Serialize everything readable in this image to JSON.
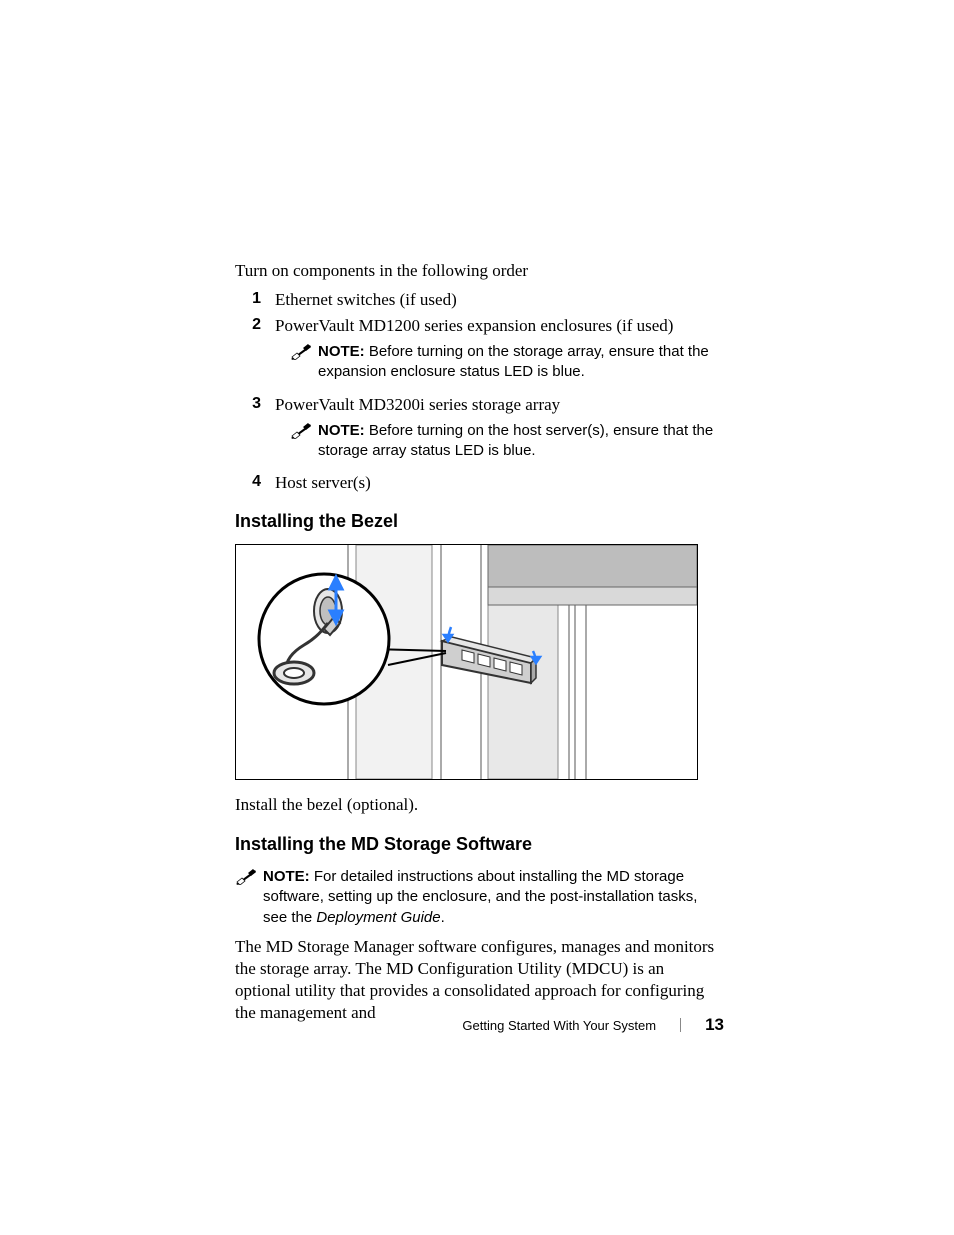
{
  "intro": "Turn on components in the following order",
  "steps": [
    {
      "n": "1",
      "text": "Ethernet switches (if used)"
    },
    {
      "n": "2",
      "text": "PowerVault MD1200 series expansion enclosures (if used)",
      "note": {
        "label": "NOTE:",
        "text": " Before turning on the storage array, ensure that the expansion enclosure status LED is blue."
      }
    },
    {
      "n": "3",
      "text": "PowerVault MD3200i series storage array",
      "note": {
        "label": "NOTE:",
        "text": " Before turning on the host server(s), ensure that the storage array status LED is blue."
      }
    },
    {
      "n": "4",
      "text": "Host server(s)"
    }
  ],
  "heading_bezel": "Installing the Bezel",
  "bezel_caption": "Install the bezel (optional).",
  "heading_software": "Installing the MD Storage Software",
  "software_note": {
    "label": "NOTE:",
    "text": " For detailed instructions about installing the MD storage software, setting up the enclosure, and the post-installation tasks, see the ",
    "emph": "Deployment Guide",
    "after": "."
  },
  "software_para": "The MD Storage Manager software configures, manages and monitors the storage array. The MD Configuration Utility (MDCU) is an optional utility that provides a consolidated approach for configuring the management and",
  "footer_text": "Getting Started With Your System",
  "page_number": "13"
}
